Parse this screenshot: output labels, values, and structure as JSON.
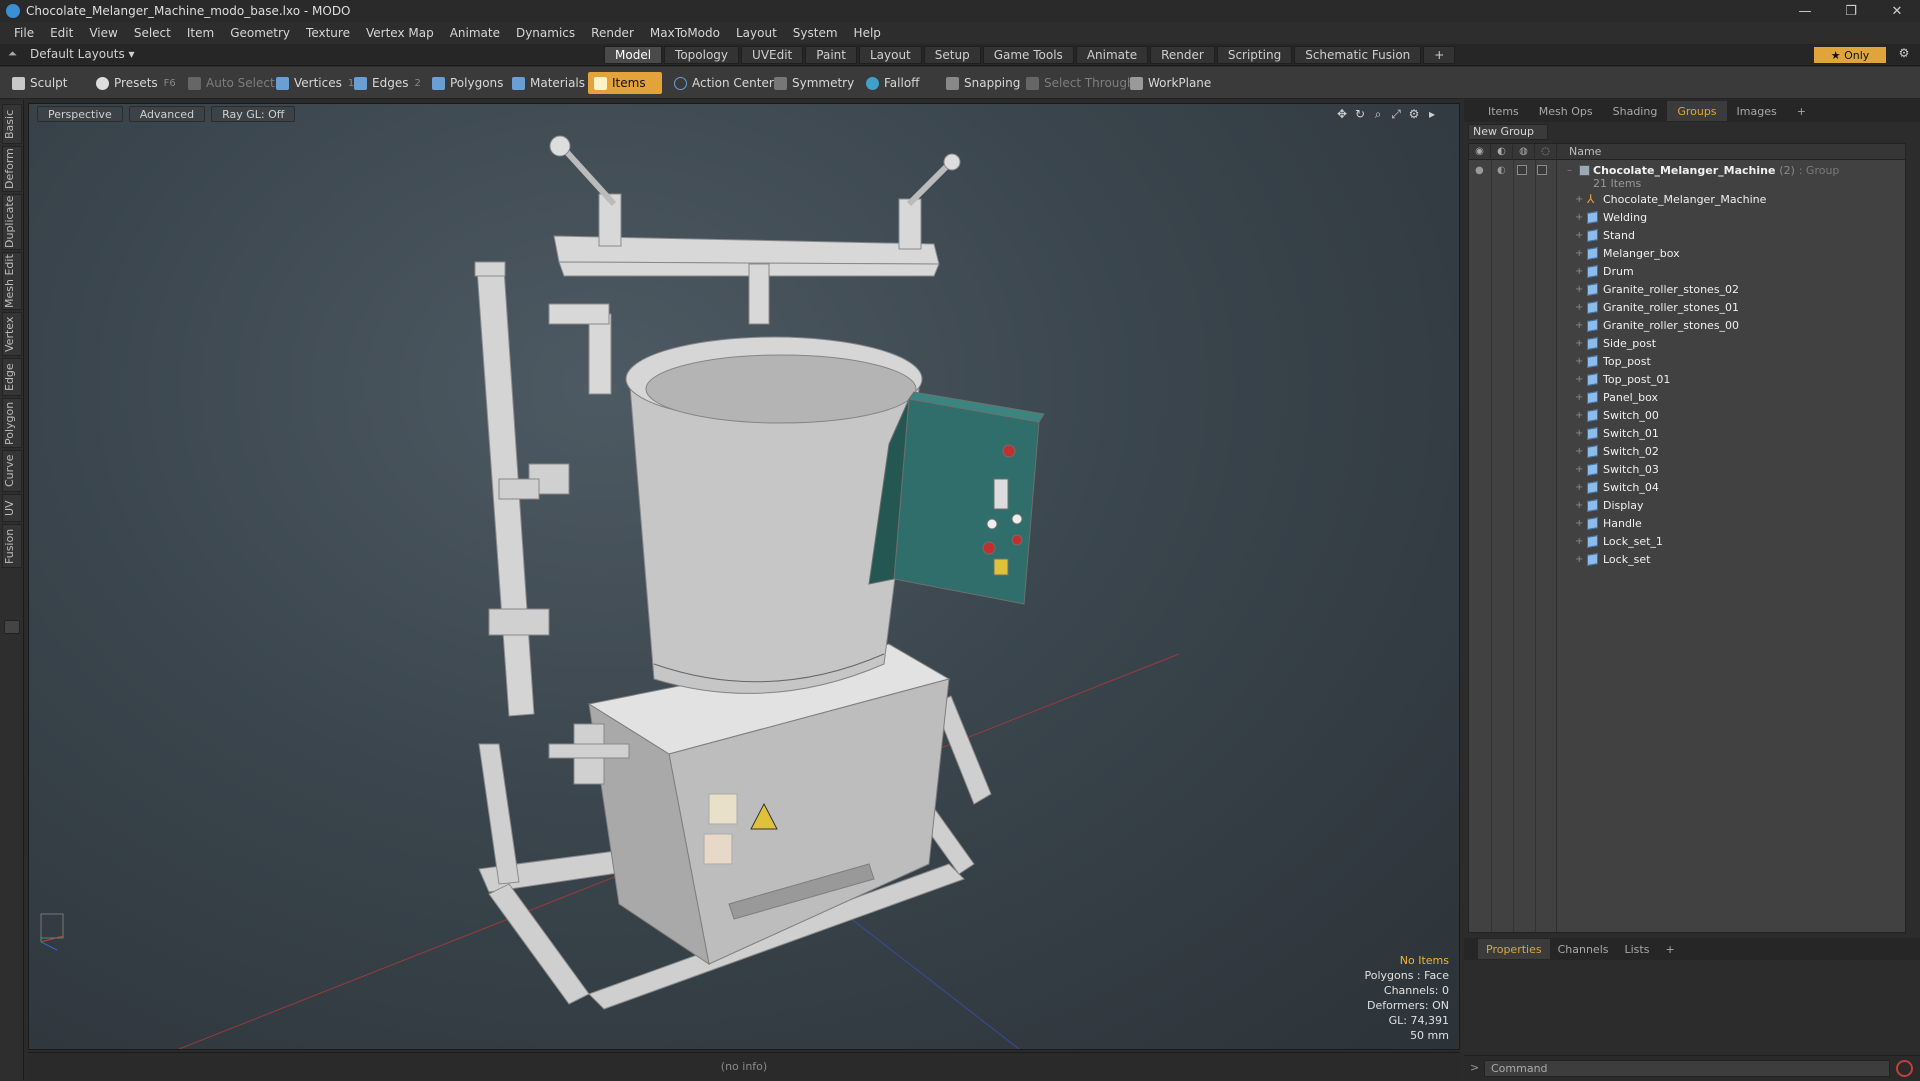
{
  "window": {
    "title": "Chocolate_Melanger_Machine_modo_base.lxo - MODO",
    "controls": [
      "—",
      "❐",
      "✕"
    ]
  },
  "menu": [
    "File",
    "Edit",
    "View",
    "Select",
    "Item",
    "Geometry",
    "Texture",
    "Vertex Map",
    "Animate",
    "Dynamics",
    "Render",
    "MaxToModo",
    "Layout",
    "System",
    "Help"
  ],
  "layout_selector": "Default Layouts ▾",
  "mode_tabs": [
    {
      "label": "Model",
      "active": true
    },
    {
      "label": "Topology",
      "active": false
    },
    {
      "label": "UVEdit",
      "active": false
    },
    {
      "label": "Paint",
      "active": false
    },
    {
      "label": "Layout",
      "active": false
    },
    {
      "label": "Setup",
      "active": false
    },
    {
      "label": "Game Tools",
      "active": false
    },
    {
      "label": "Animate",
      "active": false
    },
    {
      "label": "Render",
      "active": false
    },
    {
      "label": "Scripting",
      "active": false
    },
    {
      "label": "Schematic Fusion",
      "active": false
    },
    {
      "label": "+",
      "active": false
    }
  ],
  "only_button": "★  Only",
  "gear": "⚙",
  "toolbar": {
    "sculpt": "Sculpt",
    "presets": "Presets",
    "presets_key": "F6",
    "auto_select": "Auto Select",
    "vertices": "Vertices",
    "vertices_count": "1",
    "edges": "Edges",
    "edges_count": "2",
    "polygons": "Polygons",
    "materials": "Materials",
    "items": "Items",
    "action_center": "Action Center",
    "symmetry": "Symmetry",
    "falloff": "Falloff",
    "snapping": "Snapping",
    "select_through": "Select Through",
    "workplane": "WorkPlane"
  },
  "left_tabs": [
    "Basic",
    "Deform",
    "Duplicate",
    "Mesh Edit",
    "Vertex",
    "Edge",
    "Polygon",
    "Curve",
    "UV",
    "Fusion"
  ],
  "viewport": {
    "view": "Perspective",
    "shading": "Advanced",
    "raygl": "Ray GL: Off",
    "hud": {
      "selection": "No Items",
      "polygons": "Polygons : Face",
      "channels": "Channels: 0",
      "deformers": "Deformers: ON",
      "gl": "GL: 74,391",
      "scale": "50 mm"
    }
  },
  "status": "(no info)",
  "right_tabs": [
    {
      "label": "Items",
      "active": false
    },
    {
      "label": "Mesh Ops",
      "active": false
    },
    {
      "label": "Shading",
      "active": false
    },
    {
      "label": "Groups",
      "active": true
    },
    {
      "label": "Images",
      "active": false
    },
    {
      "label": "+",
      "active": false
    }
  ],
  "new_group": "New Group",
  "tree": {
    "name_header": "Name",
    "group": {
      "name": "Chocolate_Melanger_Machine",
      "count": "(2)",
      "type": ": Group",
      "items": "21 Items"
    },
    "items": [
      {
        "name": "Chocolate_Melanger_Machine",
        "kind": "locator"
      },
      {
        "name": "Welding",
        "kind": "mesh"
      },
      {
        "name": "Stand",
        "kind": "mesh"
      },
      {
        "name": "Melanger_box",
        "kind": "mesh"
      },
      {
        "name": "Drum",
        "kind": "mesh"
      },
      {
        "name": "Granite_roller_stones_02",
        "kind": "mesh"
      },
      {
        "name": "Granite_roller_stones_01",
        "kind": "mesh"
      },
      {
        "name": "Granite_roller_stones_00",
        "kind": "mesh"
      },
      {
        "name": "Side_post",
        "kind": "mesh"
      },
      {
        "name": "Top_post",
        "kind": "mesh"
      },
      {
        "name": "Top_post_01",
        "kind": "mesh"
      },
      {
        "name": "Panel_box",
        "kind": "mesh"
      },
      {
        "name": "Switch_00",
        "kind": "mesh"
      },
      {
        "name": "Switch_01",
        "kind": "mesh"
      },
      {
        "name": "Switch_02",
        "kind": "mesh"
      },
      {
        "name": "Switch_03",
        "kind": "mesh"
      },
      {
        "name": "Switch_04",
        "kind": "mesh"
      },
      {
        "name": "Display",
        "kind": "mesh"
      },
      {
        "name": "Handle",
        "kind": "mesh"
      },
      {
        "name": "Lock_set_1",
        "kind": "mesh"
      },
      {
        "name": "Lock_set",
        "kind": "mesh"
      }
    ]
  },
  "properties_tabs": [
    {
      "label": "Properties",
      "active": true
    },
    {
      "label": "Channels",
      "active": false
    },
    {
      "label": "Lists",
      "active": false
    },
    {
      "label": "+",
      "active": false
    }
  ],
  "command_placeholder": "Command",
  "colors": {
    "accent": "#e3a23a",
    "viewport_bg": "#3a454d",
    "mesh_icon": "#8cbcec"
  }
}
